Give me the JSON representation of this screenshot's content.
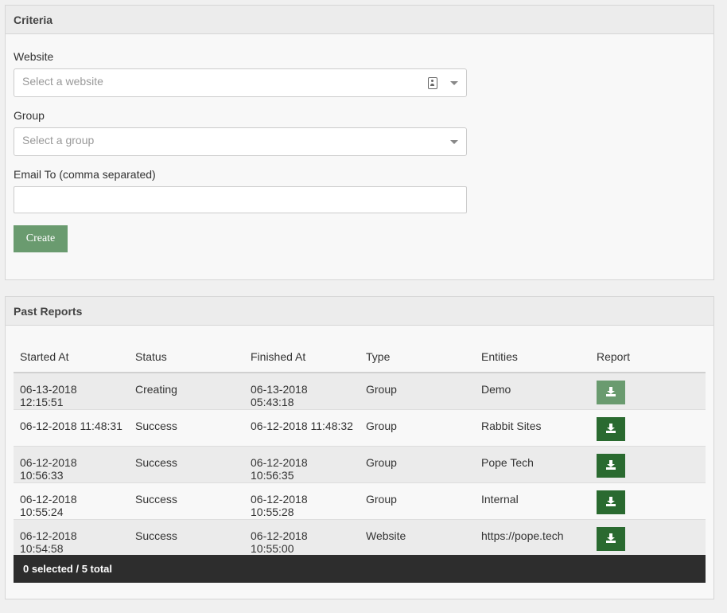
{
  "criteria": {
    "title": "Criteria",
    "website_label": "Website",
    "website_placeholder": "Select a website",
    "group_label": "Group",
    "group_placeholder": "Select a group",
    "email_label": "Email To (comma separated)",
    "email_value": "",
    "create_label": "Create"
  },
  "reports": {
    "title": "Past Reports",
    "columns": [
      "Started At",
      "Status",
      "Finished At",
      "Type",
      "Entities",
      "Report"
    ],
    "rows": [
      {
        "started": "06-13-2018 12:15:51",
        "status": "Creating",
        "finished": "06-13-2018 05:43:18",
        "type": "Group",
        "entities": "Demo",
        "report_enabled": false
      },
      {
        "started": "06-12-2018 11:48:31",
        "status": "Success",
        "finished": "06-12-2018 11:48:32",
        "type": "Group",
        "entities": "Rabbit Sites",
        "report_enabled": true
      },
      {
        "started": "06-12-2018 10:56:33",
        "status": "Success",
        "finished": "06-12-2018 10:56:35",
        "type": "Group",
        "entities": "Pope Tech",
        "report_enabled": true
      },
      {
        "started": "06-12-2018 10:55:24",
        "status": "Success",
        "finished": "06-12-2018 10:55:28",
        "type": "Group",
        "entities": "Internal",
        "report_enabled": true
      },
      {
        "started": "06-12-2018 10:54:58",
        "status": "Success",
        "finished": "06-12-2018 10:55:00",
        "type": "Website",
        "entities": "https://pope.tech",
        "report_enabled": true
      }
    ],
    "footer": "0 selected / 5 total"
  },
  "colors": {
    "button_primary": "#2a6a30",
    "button_disabled": "#6a9b6f",
    "footer_bg": "#2d2d2d"
  },
  "icons": {
    "website_select_icon": "contact-card-icon",
    "report_icon": "download-icon",
    "select_caret": "chevron-down-icon"
  }
}
